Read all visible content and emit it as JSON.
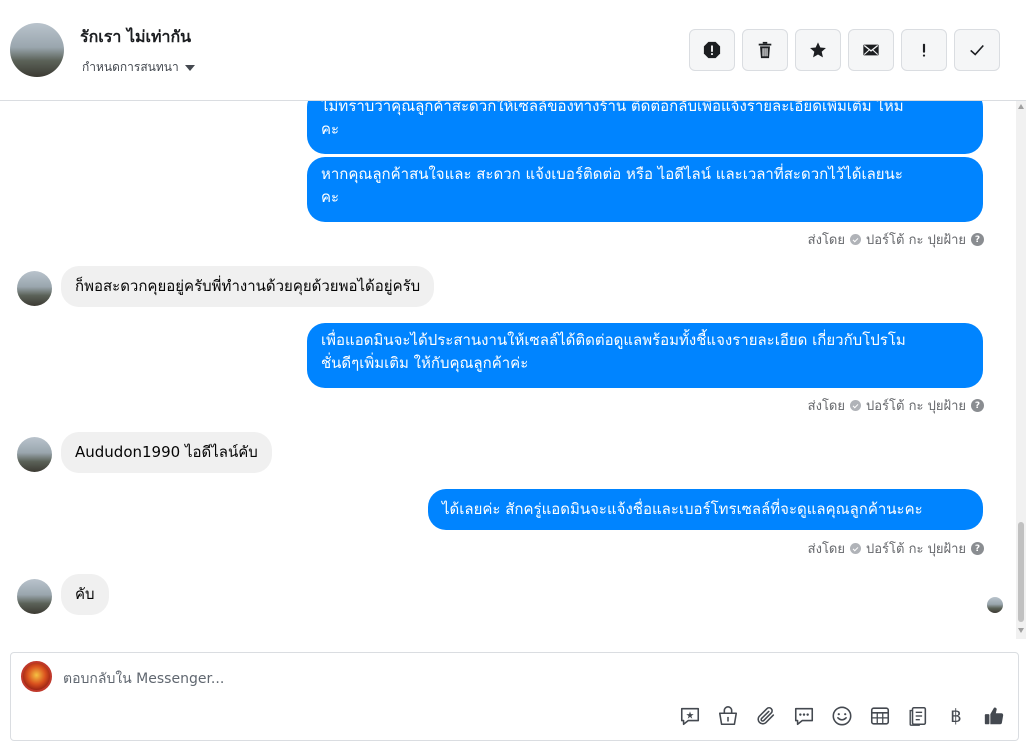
{
  "header": {
    "name": "รักเรา ไม่เท่ากัน",
    "assign_label": "กำหนดการสนทนา",
    "tools": [
      {
        "icon": "report-icon",
        "label": "report"
      },
      {
        "icon": "trash-icon",
        "label": "delete"
      },
      {
        "icon": "star-icon",
        "label": "star"
      },
      {
        "icon": "envelope-icon",
        "label": "mark-unread"
      },
      {
        "icon": "exclamation-icon",
        "label": "spam"
      },
      {
        "icon": "check-icon",
        "label": "done"
      }
    ]
  },
  "messages": [
    {
      "from": "page",
      "text_lines": [
        "ไม่ทราบว่าคุณลูกค้าสะดวกให้เซลล์ของทางร้าน ติดต่อกลับเพื่อแจ้งรายละเอียดเพิ่มเติม ไหม",
        "คะ"
      ]
    },
    {
      "from": "page",
      "text_lines": [
        "หากคุณลูกค้าสนใจและ สะดวก แจ้งเบอร์ติดต่อ หรือ ไอดีไลน์ และเวลาที่สะดวกไว้ได้เลยนะ",
        "คะ"
      ]
    },
    {
      "from": "user",
      "text": "ก็พอสะดวกคุยอยู่ครับพี่ทำงานด้วยคุยด้วยพอได้อยู่ครับ"
    },
    {
      "from": "page",
      "text_lines": [
        "เพื่อแอดมินจะได้ประสานงานให้เซลล์ได้ติดต่อดูแลพร้อมทั้งชี้แจงรายละเอียด เกี่ยวกับโปรโม",
        "ชั่นดีๆเพิ่มเติม ให้กับคุณลูกค้าค่ะ"
      ]
    },
    {
      "from": "user",
      "text": "Aududon1990 ไอดีไลน์คับ"
    },
    {
      "from": "page",
      "text": "ได้เลยค่ะ สักครู่แอดมินจะแจ้งชื่อและเบอร์โทรเซลล์ที่จะดูแลคุณลูกค้านะคะ"
    },
    {
      "from": "user",
      "text": "คับ"
    }
  ],
  "sender": {
    "prefix": "ส่งโดย",
    "name": "ปอร์โต้ กะ ปุยฝ้าย",
    "help": "?"
  },
  "composer": {
    "placeholder": "ตอบกลับใน Messenger...",
    "tools": [
      "quick-reply-icon",
      "shop-bag-icon",
      "attachment-icon",
      "saved-replies-icon",
      "emoji-icon",
      "table-icon",
      "notes-icon",
      "baht-icon",
      "like-icon"
    ],
    "baht_symbol": "฿"
  },
  "colors": {
    "outgoing_bubble": "#0084ff",
    "incoming_bubble": "#f0f0f0"
  }
}
